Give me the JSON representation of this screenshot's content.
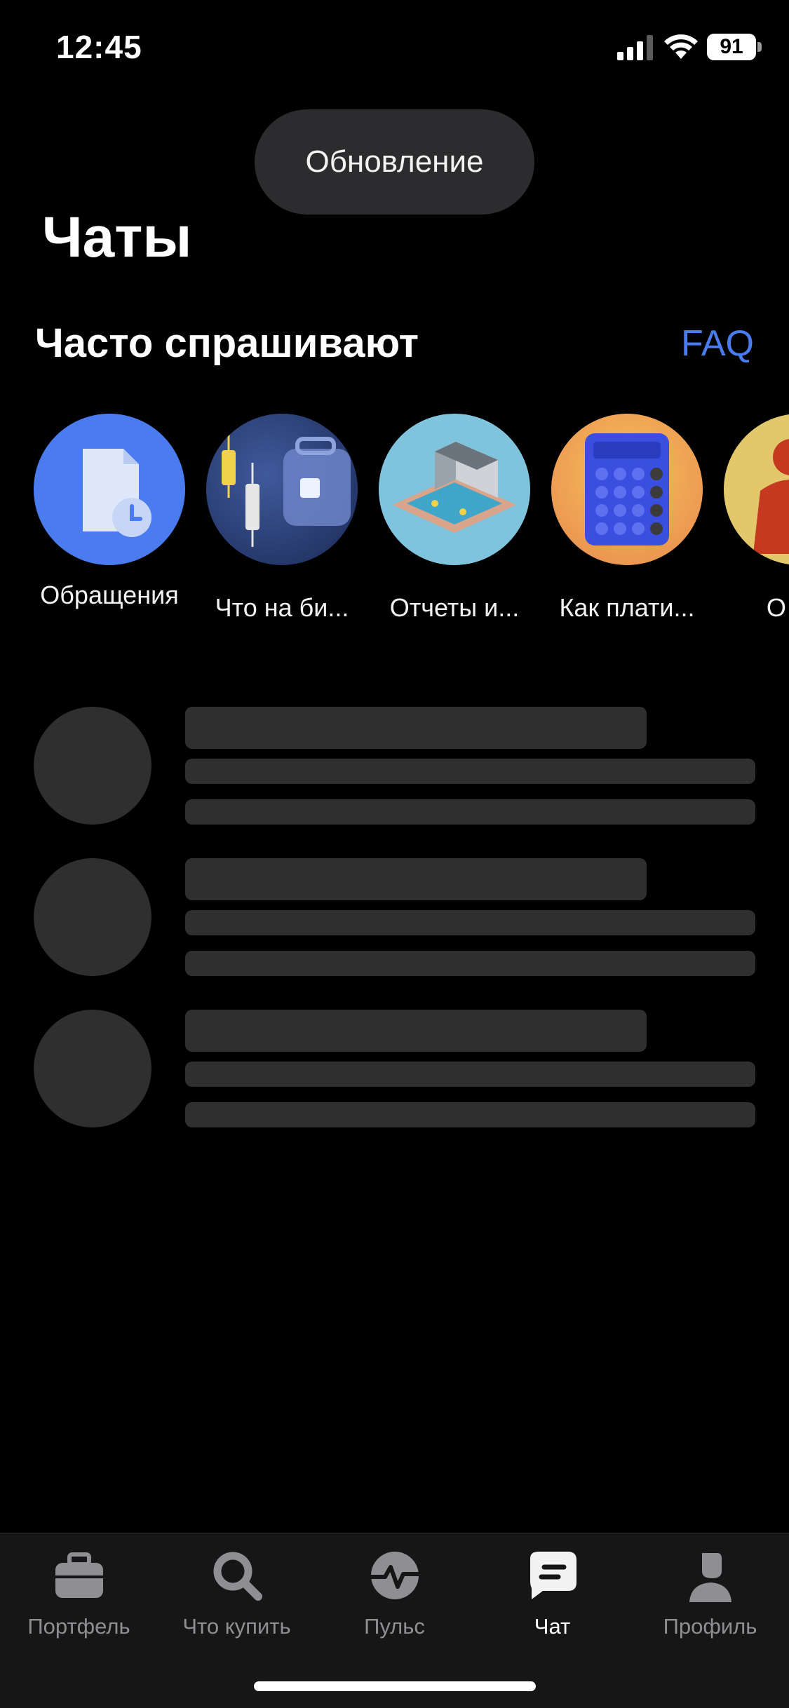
{
  "status_bar": {
    "time": "12:45",
    "battery": "91"
  },
  "toast": {
    "text": "Обновление"
  },
  "page": {
    "title": "Чаты"
  },
  "faq": {
    "header": "Часто спрашивают",
    "link": "FAQ"
  },
  "stories": [
    {
      "label": "Обращения",
      "icon": "document-clock-icon"
    },
    {
      "label": "Что на би...",
      "icon": "candles-briefcase-icon"
    },
    {
      "label": "Отчеты и...",
      "icon": "isometric-building-icon"
    },
    {
      "label": "Как плати...",
      "icon": "calculator-icon"
    },
    {
      "label": "О тар",
      "icon": "statue-icon"
    }
  ],
  "tabs": [
    {
      "label": "Портфель",
      "icon": "briefcase-icon"
    },
    {
      "label": "Что купить",
      "icon": "search-icon"
    },
    {
      "label": "Пульс",
      "icon": "pulse-icon"
    },
    {
      "label": "Чат",
      "icon": "chat-icon",
      "active": true
    },
    {
      "label": "Профиль",
      "icon": "profile-icon"
    }
  ],
  "colors": {
    "accent": "#4a7cf0",
    "background": "#000000",
    "skeleton": "#2f2f2f"
  }
}
